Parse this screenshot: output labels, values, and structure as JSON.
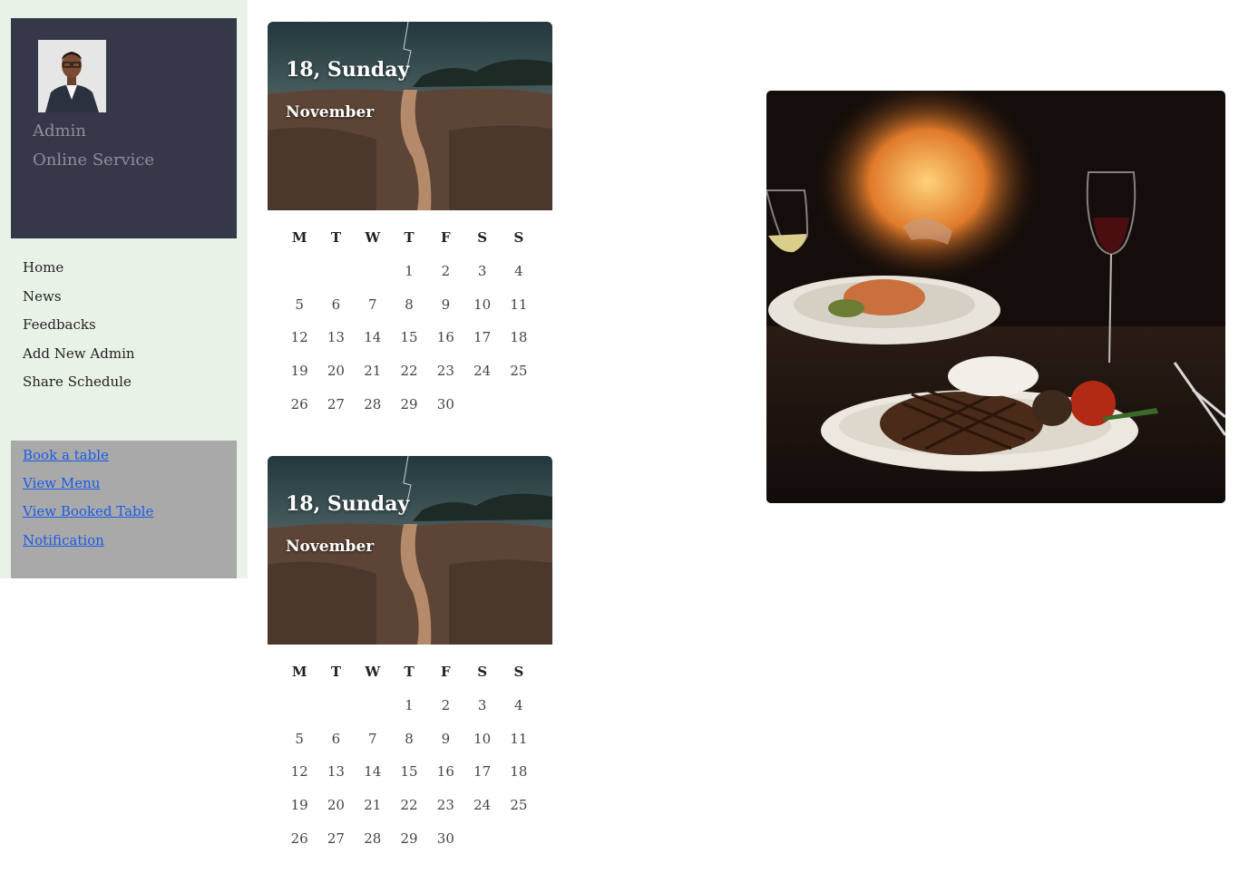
{
  "sidebar": {
    "profile": {
      "name": "Admin",
      "role": "Online Service"
    },
    "nav": [
      "Home",
      "News",
      "Feedbacks",
      "Add New Admin",
      "Share Schedule"
    ],
    "links": [
      "Book a table",
      "View Menu",
      "View Booked Table",
      "Notification"
    ]
  },
  "calendars": [
    {
      "day": "18, Sunday",
      "month": "November",
      "weekdays": [
        "M",
        "T",
        "W",
        "T",
        "F",
        "S",
        "S"
      ],
      "weeks": [
        [
          "",
          "",
          "",
          "1",
          "2",
          "3",
          "4"
        ],
        [
          "5",
          "6",
          "7",
          "8",
          "9",
          "10",
          "11"
        ],
        [
          "12",
          "13",
          "14",
          "15",
          "16",
          "17",
          "18"
        ],
        [
          "19",
          "20",
          "21",
          "22",
          "23",
          "24",
          "25"
        ],
        [
          "26",
          "27",
          "28",
          "29",
          "30",
          "",
          ""
        ]
      ]
    },
    {
      "day": "18, Sunday",
      "month": "November",
      "weekdays": [
        "M",
        "T",
        "W",
        "T",
        "F",
        "S",
        "S"
      ],
      "weeks": [
        [
          "",
          "",
          "",
          "1",
          "2",
          "3",
          "4"
        ],
        [
          "5",
          "6",
          "7",
          "8",
          "9",
          "10",
          "11"
        ],
        [
          "12",
          "13",
          "14",
          "15",
          "16",
          "17",
          "18"
        ],
        [
          "19",
          "20",
          "21",
          "22",
          "23",
          "24",
          "25"
        ],
        [
          "26",
          "27",
          "28",
          "29",
          "30",
          "",
          ""
        ]
      ]
    }
  ],
  "colors": {
    "sidebar_bg": "#e9f2e6",
    "profile_bg": "#353849",
    "links_bg": "#a9a9a9",
    "link": "#1a5ce6"
  }
}
